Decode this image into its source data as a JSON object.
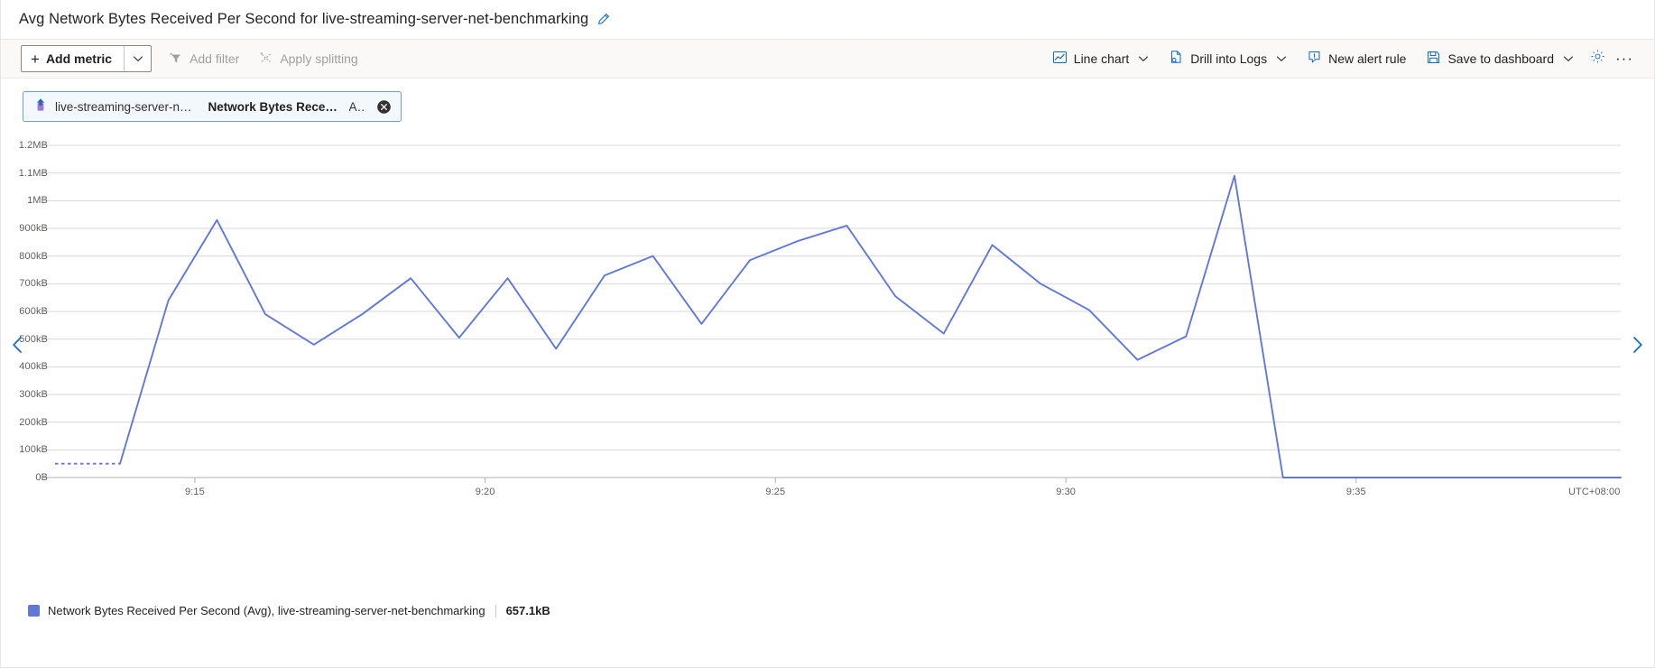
{
  "header": {
    "title": "Avg Network Bytes Received Per Second for live-streaming-server-net-benchmarking",
    "edit_icon": "pencil-icon"
  },
  "toolbar": {
    "add_metric_label": "Add metric",
    "add_metric_icon": "plus-icon",
    "add_metric_caret_icon": "chevron-down-icon",
    "add_filter_label": "Add filter",
    "add_filter_icon": "filter-icon",
    "apply_splitting_label": "Apply splitting",
    "apply_splitting_icon": "splitting-icon",
    "line_chart_label": "Line chart",
    "line_chart_icon": "line-chart-icon",
    "drill_into_logs_label": "Drill into Logs",
    "drill_into_logs_icon": "logs-icon",
    "new_alert_rule_label": "New alert rule",
    "new_alert_rule_icon": "alert-bell-icon",
    "save_to_dashboard_label": "Save to dashboard",
    "save_to_dashboard_icon": "save-disk-icon",
    "settings_icon": "gear-icon",
    "more_label": "···",
    "more_icon": "ellipsis-icon"
  },
  "metric_chip": {
    "resource_icon": "azure-resource-icon",
    "resource": "live-streaming-server-net-...",
    "metric": "Network Bytes Receive...",
    "aggregation": "A...",
    "close_icon": "close-circle-icon"
  },
  "navigation": {
    "prev_icon": "chevron-left-icon",
    "next_icon": "chevron-right-icon"
  },
  "legend": {
    "swatch_color": "#6278d8",
    "label": "Network Bytes Received Per Second (Avg), live-streaming-server-net-benchmarking",
    "value": "657.1kB"
  },
  "chart_data": {
    "type": "line",
    "title": "Avg Network Bytes Received Per Second for live-streaming-server-net-benchmarking",
    "xlabel": "",
    "ylabel": "",
    "timezone": "UTC+08:00",
    "grid": true,
    "legend_position": "bottom-left",
    "line_color": "#6278d8",
    "y_tick_labels": [
      "1.2MB",
      "1.1MB",
      "1MB",
      "900kB",
      "800kB",
      "700kB",
      "600kB",
      "500kB",
      "400kB",
      "300kB",
      "200kB",
      "100kB",
      "0B"
    ],
    "y_tick_values": [
      1200000,
      1100000,
      1000000,
      900000,
      800000,
      700000,
      600000,
      500000,
      400000,
      300000,
      200000,
      100000,
      0
    ],
    "ylim": [
      0,
      1200000
    ],
    "x_tick_labels": [
      "9:15",
      "9:20",
      "9:25",
      "9:30",
      "9:35"
    ],
    "x_tick_positions": [
      0.0893,
      0.2747,
      0.4601,
      0.6456,
      0.831
    ],
    "series": [
      {
        "name": "Network Bytes Received Per Second (Avg), live-streaming-server-net-benchmarking",
        "unit": "bytes",
        "leading_dashed_segment": {
          "x": [
            0.0,
            0.0415
          ],
          "y": [
            50000,
            50000
          ]
        },
        "x": [
          0.0415,
          0.0724,
          0.1034,
          0.1343,
          0.1653,
          0.1962,
          0.2272,
          0.2581,
          0.2891,
          0.32,
          0.351,
          0.3819,
          0.4129,
          0.4438,
          0.4748,
          0.5057,
          0.5367,
          0.5676,
          0.5986,
          0.6295,
          0.6605,
          0.6914,
          0.7224,
          0.7533,
          0.7843,
          0.8152,
          0.8462,
          0.8771,
          0.9081,
          0.939,
          0.97,
          1.0
        ],
        "y": [
          50000,
          640000,
          930000,
          590000,
          480000,
          590000,
          720000,
          505000,
          720000,
          465000,
          730000,
          800000,
          555000,
          785000,
          855000,
          910000,
          655000,
          520000,
          840000,
          700000,
          605000,
          425000,
          510000,
          1090000,
          0,
          0,
          0,
          0,
          0,
          0,
          0,
          0
        ]
      }
    ],
    "rendered_points": [
      {
        "t": "start",
        "v": 50000
      },
      {
        "t": "p1",
        "v": 640000
      },
      {
        "t": "p2",
        "v": 930000
      },
      {
        "t": "p3",
        "v": 590000
      },
      {
        "t": "p4",
        "v": 480000
      },
      {
        "t": "p5",
        "v": 590000
      },
      {
        "t": "p6",
        "v": 720000
      },
      {
        "t": "p7",
        "v": 505000
      },
      {
        "t": "p8",
        "v": 720000
      },
      {
        "t": "p9",
        "v": 465000
      },
      {
        "t": "p10",
        "v": 730000
      },
      {
        "t": "p11",
        "v": 800000
      },
      {
        "t": "p12",
        "v": 555000
      },
      {
        "t": "p13",
        "v": 785000
      },
      {
        "t": "p14",
        "v": 855000
      },
      {
        "t": "p15",
        "v": 910000
      },
      {
        "t": "p16",
        "v": 655000
      },
      {
        "t": "p17",
        "v": 520000
      },
      {
        "t": "p18",
        "v": 840000
      },
      {
        "t": "p19",
        "v": 700000
      },
      {
        "t": "p20",
        "v": 605000
      },
      {
        "t": "p21",
        "v": 425000
      },
      {
        "t": "p22",
        "v": 510000
      },
      {
        "t": "p23",
        "v": 1090000
      },
      {
        "t": "end",
        "v": 0
      }
    ]
  }
}
